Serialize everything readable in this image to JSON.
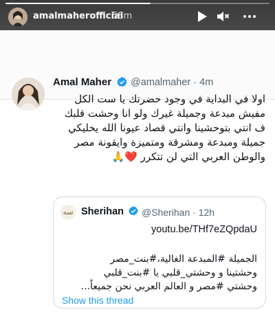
{
  "story": {
    "username": "amalmaherofficial",
    "time": "58m",
    "progress": 0.55,
    "controls": [
      {
        "name": "play-icon"
      },
      {
        "name": "mute-icon"
      },
      {
        "name": "more-options-icon"
      }
    ]
  },
  "tweet": {
    "name": "Amal Maher",
    "handle": "@amalmaher · 4m",
    "lines": [
      "اولا في البداية في وجود حضرتك يا ست الكل",
      "مفيش مبدعة وجميلة غيرك  ولو انا وحشت قلبك",
      "ف انتي بتوحشينا وانتي قصاد عيونا الله يخليكي",
      "جميلة ومبدعة ومشرقة ومتميزة وايقونة مصر",
      "والوطن العربي التي لن تتكرر ❤️🙏"
    ]
  },
  "quote": {
    "logo_text": "سه",
    "name": "Sherihan",
    "handle": "@Sherihan · 12h",
    "link": "youtu.be/THf7eZQpdaU",
    "lines": [
      "الجميلة #المبدعة الغالية،#بنت_مصر",
      "وحشتينا و وحشتي_قلبي يا #بنت_قلبي",
      "وحشتي #مصر و العالم العربي نحن جميعاً..."
    ],
    "show_thread": "Show this thread"
  },
  "colors": {
    "accent": "#1d9bf0",
    "text": "#0f1419",
    "secondary": "#536471",
    "heart": "#e0245e"
  }
}
